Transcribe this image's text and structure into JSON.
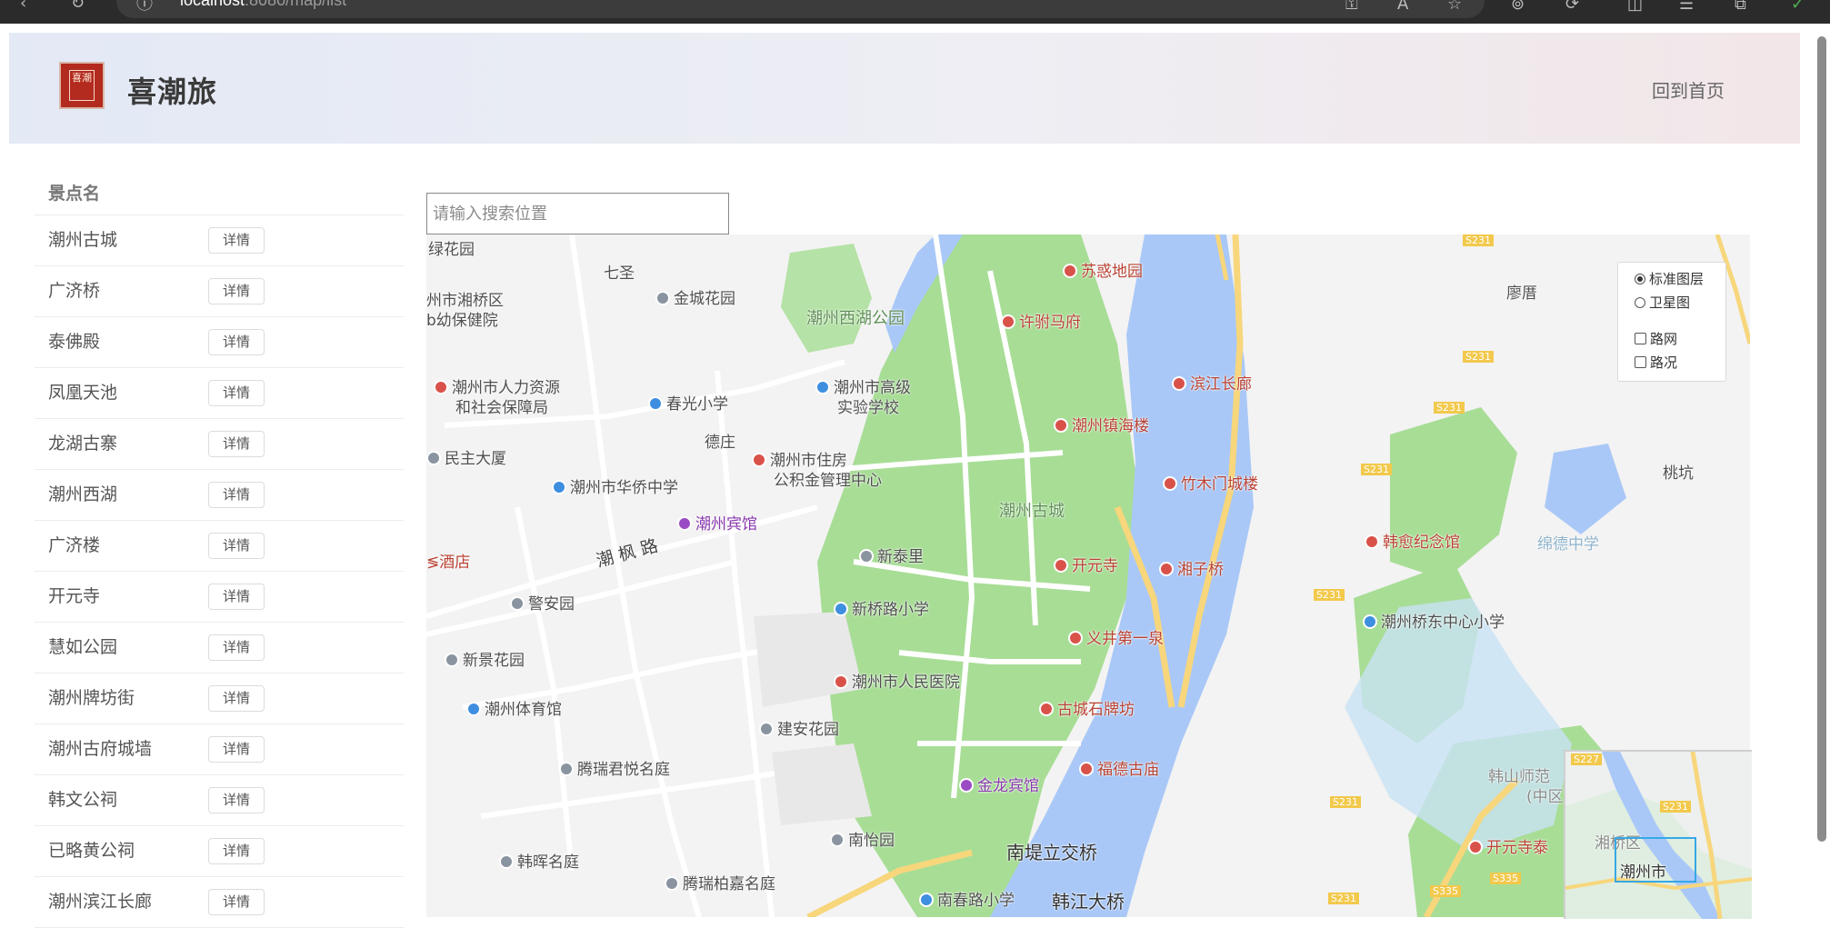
{
  "browser": {
    "url_host": "localhost",
    "url_rest": ":8080/map/list"
  },
  "header": {
    "brand": "喜潮旅",
    "logo_text": "喜潮",
    "home_link": "回到首页"
  },
  "list": {
    "header": "景点名",
    "detail_label": "详情",
    "items": [
      "潮州古城",
      "广济桥",
      "泰佛殿",
      "凤凰天池",
      "龙湖古寨",
      "潮州西湖",
      "广济楼",
      "开元寺",
      "慧如公园",
      "潮州牌坊街",
      "潮州古府城墙",
      "韩文公祠",
      "已略黄公祠",
      "潮州滨江长廊"
    ]
  },
  "search": {
    "placeholder": "请输入搜索位置"
  },
  "map_layers": {
    "standard": "标准图层",
    "satellite": "卫星图",
    "roads": "路网",
    "traffic": "路况",
    "selected": "standard"
  },
  "map_labels": {
    "lvhuayuan": "绿花园",
    "qisheng": "七圣",
    "jinchenghuayuan": "金城花园",
    "xihupark": "潮州西湖公园",
    "suxidiyuan": "苏惑地园",
    "xumafu": "许驸马府",
    "baoqiao_1": "州市湘桥区",
    "baoqiao_2": "b幼保健院",
    "renli_1": "潮州市人力资源",
    "renli_2": "和社会保障局",
    "chunguang": "春光小学",
    "gaoji_1": "潮州市高级",
    "gaoji_2": "实验学校",
    "binjiang": "滨江长廊",
    "zhenhailou": "潮州镇海楼",
    "dezhuang": "德庄",
    "minzhu": "民主大厦",
    "zhufang_1": "潮州市住房",
    "zhufang_2": "公积金管理中心",
    "huaqiao": "潮州市华侨中学",
    "zhumumen": "竹木门城楼",
    "guchengarea": "潮州古城",
    "binguan": "潮州宾馆",
    "chaofenglu": "潮 枫 路",
    "jiudian": "≶酒店",
    "xintaili": "新泰里",
    "kaiyuansi": "开元寺",
    "xiangziqiao": "湘子桥",
    "jinganyuan": "警安园",
    "xinqiaolu": "新桥路小学",
    "yijing": "义井第一泉",
    "xinjinghuayuan": "新景花园",
    "renminyiyuan": "潮州市人民医院",
    "tiyuguan": "潮州体育馆",
    "paifang": "古城石牌坊",
    "jianan": "建安花园",
    "fudemiao": "福德古庙",
    "tengrui": "腾瑞君悦名庭",
    "jinlong": "金龙宾馆",
    "nanyiyuan": "南怡园",
    "nandi": "南堤立交桥",
    "hanhui": "韩晖名庭",
    "tengruibai": "腾瑞柏嘉名庭",
    "nanchunlu": "南春路小学",
    "hanjiang": "韩江大桥",
    "liaoding": "廖厝",
    "taokeng": "桃坑",
    "hanyu": "韩愈纪念馆",
    "qiaodongzhong": "绵德中学",
    "qiaodongxiao": "潮州桥东中心小学",
    "hanshan_1": "韩山师范",
    "hanshan_2": "(中区",
    "kaiyuan2": "开元寺泰",
    "road_s231": "S231",
    "road_s335": "S335",
    "road_s227": "S227",
    "ov_xiangqiao": "湘桥区",
    "ov_chaozhou": "潮州市"
  }
}
